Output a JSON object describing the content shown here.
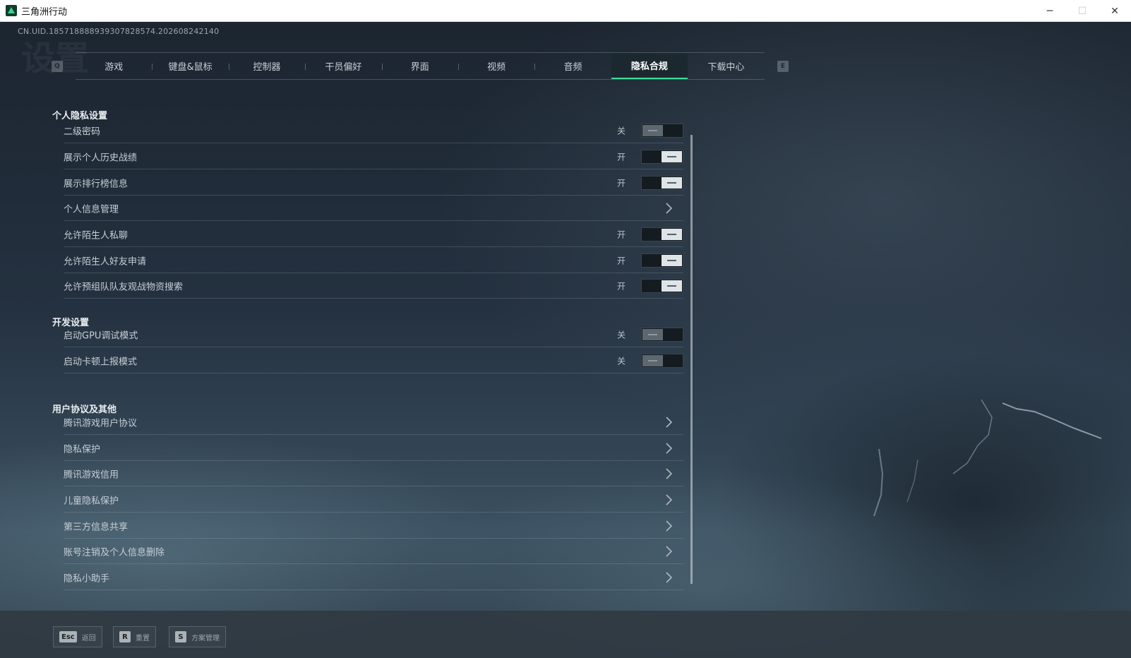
{
  "window": {
    "title": "三角洲行动",
    "minimize": "─",
    "maximize": "☐",
    "close": "✕"
  },
  "uid": "CN.UID.1857188889393078285­74.202608242140",
  "tabs": {
    "left_key": "Q",
    "right_key": "E",
    "items": [
      "游戏",
      "键盘&鼠标",
      "控制器",
      "干员偏好",
      "界面",
      "视频",
      "音频",
      "隐私合规",
      "下载中心"
    ],
    "active": "隐私合规"
  },
  "sections": {
    "privacy": {
      "title": "个人隐私设置",
      "rows": [
        {
          "label": "二级密码",
          "state": "关"
        },
        {
          "label": "展示个人历史战绩",
          "state": "开"
        },
        {
          "label": "展示排行榜信息",
          "state": "开"
        },
        {
          "label": "个人信息管理"
        },
        {
          "label": "允许陌生人私聊",
          "state": "开"
        },
        {
          "label": "允许陌生人好友申请",
          "state": "开"
        },
        {
          "label": "允许预组队队友观战物资搜索",
          "state": "开"
        }
      ]
    },
    "dev": {
      "title": "开发设置",
      "rows": [
        {
          "label": "启动GPU调试模式",
          "state": "关"
        },
        {
          "label": "启动卡顿上报模式",
          "state": "关"
        }
      ]
    },
    "agreements": {
      "title": "用户协议及其他",
      "rows": [
        {
          "label": "腾讯游戏用户协议"
        },
        {
          "label": "隐私保护"
        },
        {
          "label": "腾讯游戏信用"
        },
        {
          "label": "儿童隐私保护"
        },
        {
          "label": "第三方信息共享"
        },
        {
          "label": "账号注销及个人信息删除"
        },
        {
          "label": "隐私小助手"
        }
      ]
    }
  },
  "bottom": {
    "back": {
      "key": "Esc",
      "label": "返回"
    },
    "reset": {
      "key": "R",
      "label": "重置"
    },
    "profiles": {
      "key": "S",
      "label": "方案管理"
    }
  },
  "colors": {
    "accent": "#3ddc97",
    "toggle_on_knob": "#dfe4e7",
    "toggle_off_knob": "#5d676f"
  }
}
